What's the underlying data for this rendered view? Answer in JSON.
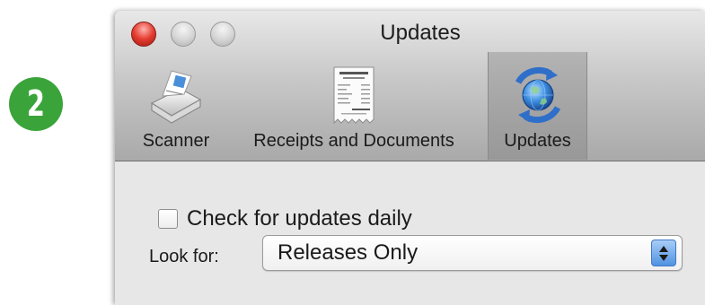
{
  "step_badge": {
    "number": "2",
    "color": "#3aa43a"
  },
  "window": {
    "title": "Updates",
    "traffic_lights": [
      "close-icon",
      "minimize-icon",
      "zoom-icon"
    ]
  },
  "toolbar": {
    "tabs": [
      {
        "label": "Scanner",
        "icon": "scanner-icon",
        "selected": false
      },
      {
        "label": "Receipts and Documents",
        "icon": "receipt-icon",
        "selected": false
      },
      {
        "label": "Updates",
        "icon": "updates-globe-icon",
        "selected": true
      }
    ]
  },
  "settings": {
    "check_daily": {
      "label": "Check for updates daily",
      "checked": false
    },
    "look_for": {
      "label": "Look for:",
      "value": "Releases Only"
    }
  }
}
